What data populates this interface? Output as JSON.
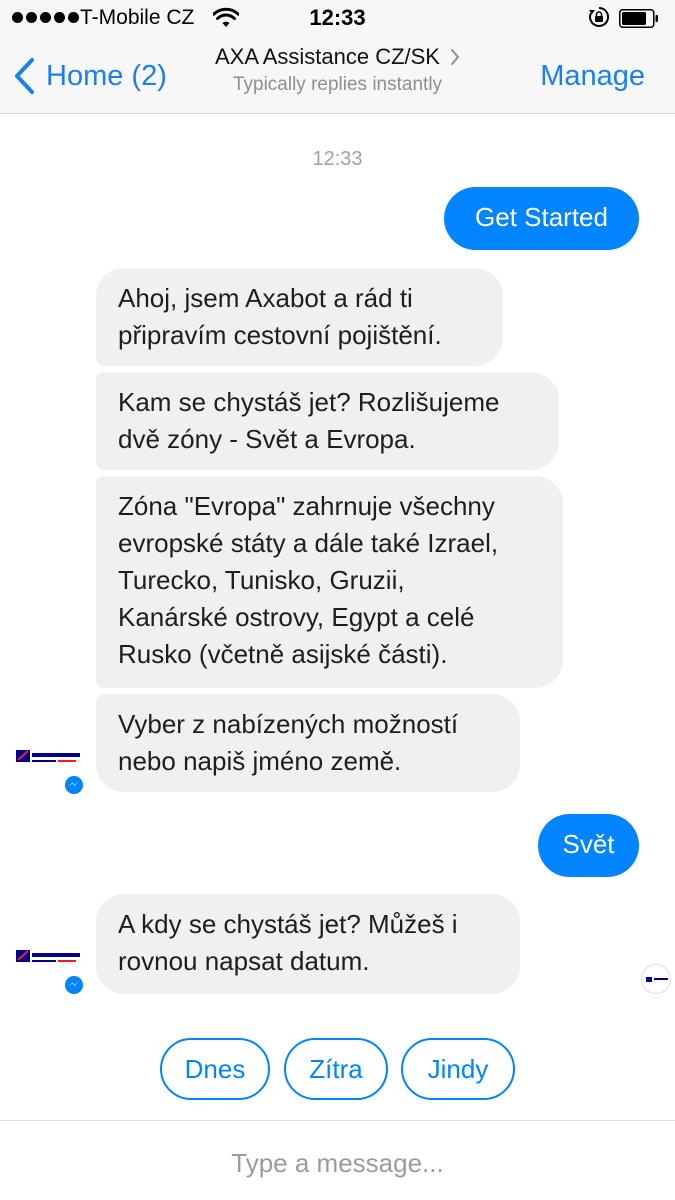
{
  "status_bar": {
    "carrier": "T-Mobile CZ",
    "time": "12:33",
    "signal_icon": "signal-dots-icon",
    "wifi_icon": "wifi-icon",
    "rotation_lock_icon": "rotation-lock-icon",
    "battery_icon": "battery-icon"
  },
  "nav": {
    "back_label": "Home (2)",
    "title": "AXA Assistance CZ/SK",
    "subtitle": "Typically replies instantly",
    "manage_label": "Manage"
  },
  "chat": {
    "timestamp": "12:33",
    "messages": [
      {
        "from": "user",
        "text": "Get Started"
      },
      {
        "from": "bot",
        "text": "Ahoj, jsem Axabot a rád ti\npřipravím cestovní pojištění."
      },
      {
        "from": "bot",
        "text": "Kam se chystáš jet? Rozlišujeme\ndvě zóny - Svět a Evropa."
      },
      {
        "from": "bot",
        "text": "Zóna \"Evropa\" zahrnuje všechny\nevropské státy a dále také Izrael,\nTurecko, Tunisko, Gruzii,\nKanárské ostrovy, Egypt a celé\nRusko (včetně asijské části)."
      },
      {
        "from": "bot",
        "text": "Vyber z nabízených možností\nnebo napiš jméno země."
      },
      {
        "from": "user",
        "text": "Svět"
      },
      {
        "from": "bot",
        "text": "A kdy se chystáš jet? Můžeš i\nrovnou napsat datum."
      }
    ]
  },
  "quick_replies": [
    "Dnes",
    "Zítra",
    "Jindy"
  ],
  "composer": {
    "placeholder": "Type a message..."
  },
  "colors": {
    "accent": "#1a7ff4",
    "user_bubble": "#0084ff",
    "bot_bubble": "#f1f0f0",
    "axa_blue": "#00008f",
    "axa_red": "#ff1721"
  }
}
